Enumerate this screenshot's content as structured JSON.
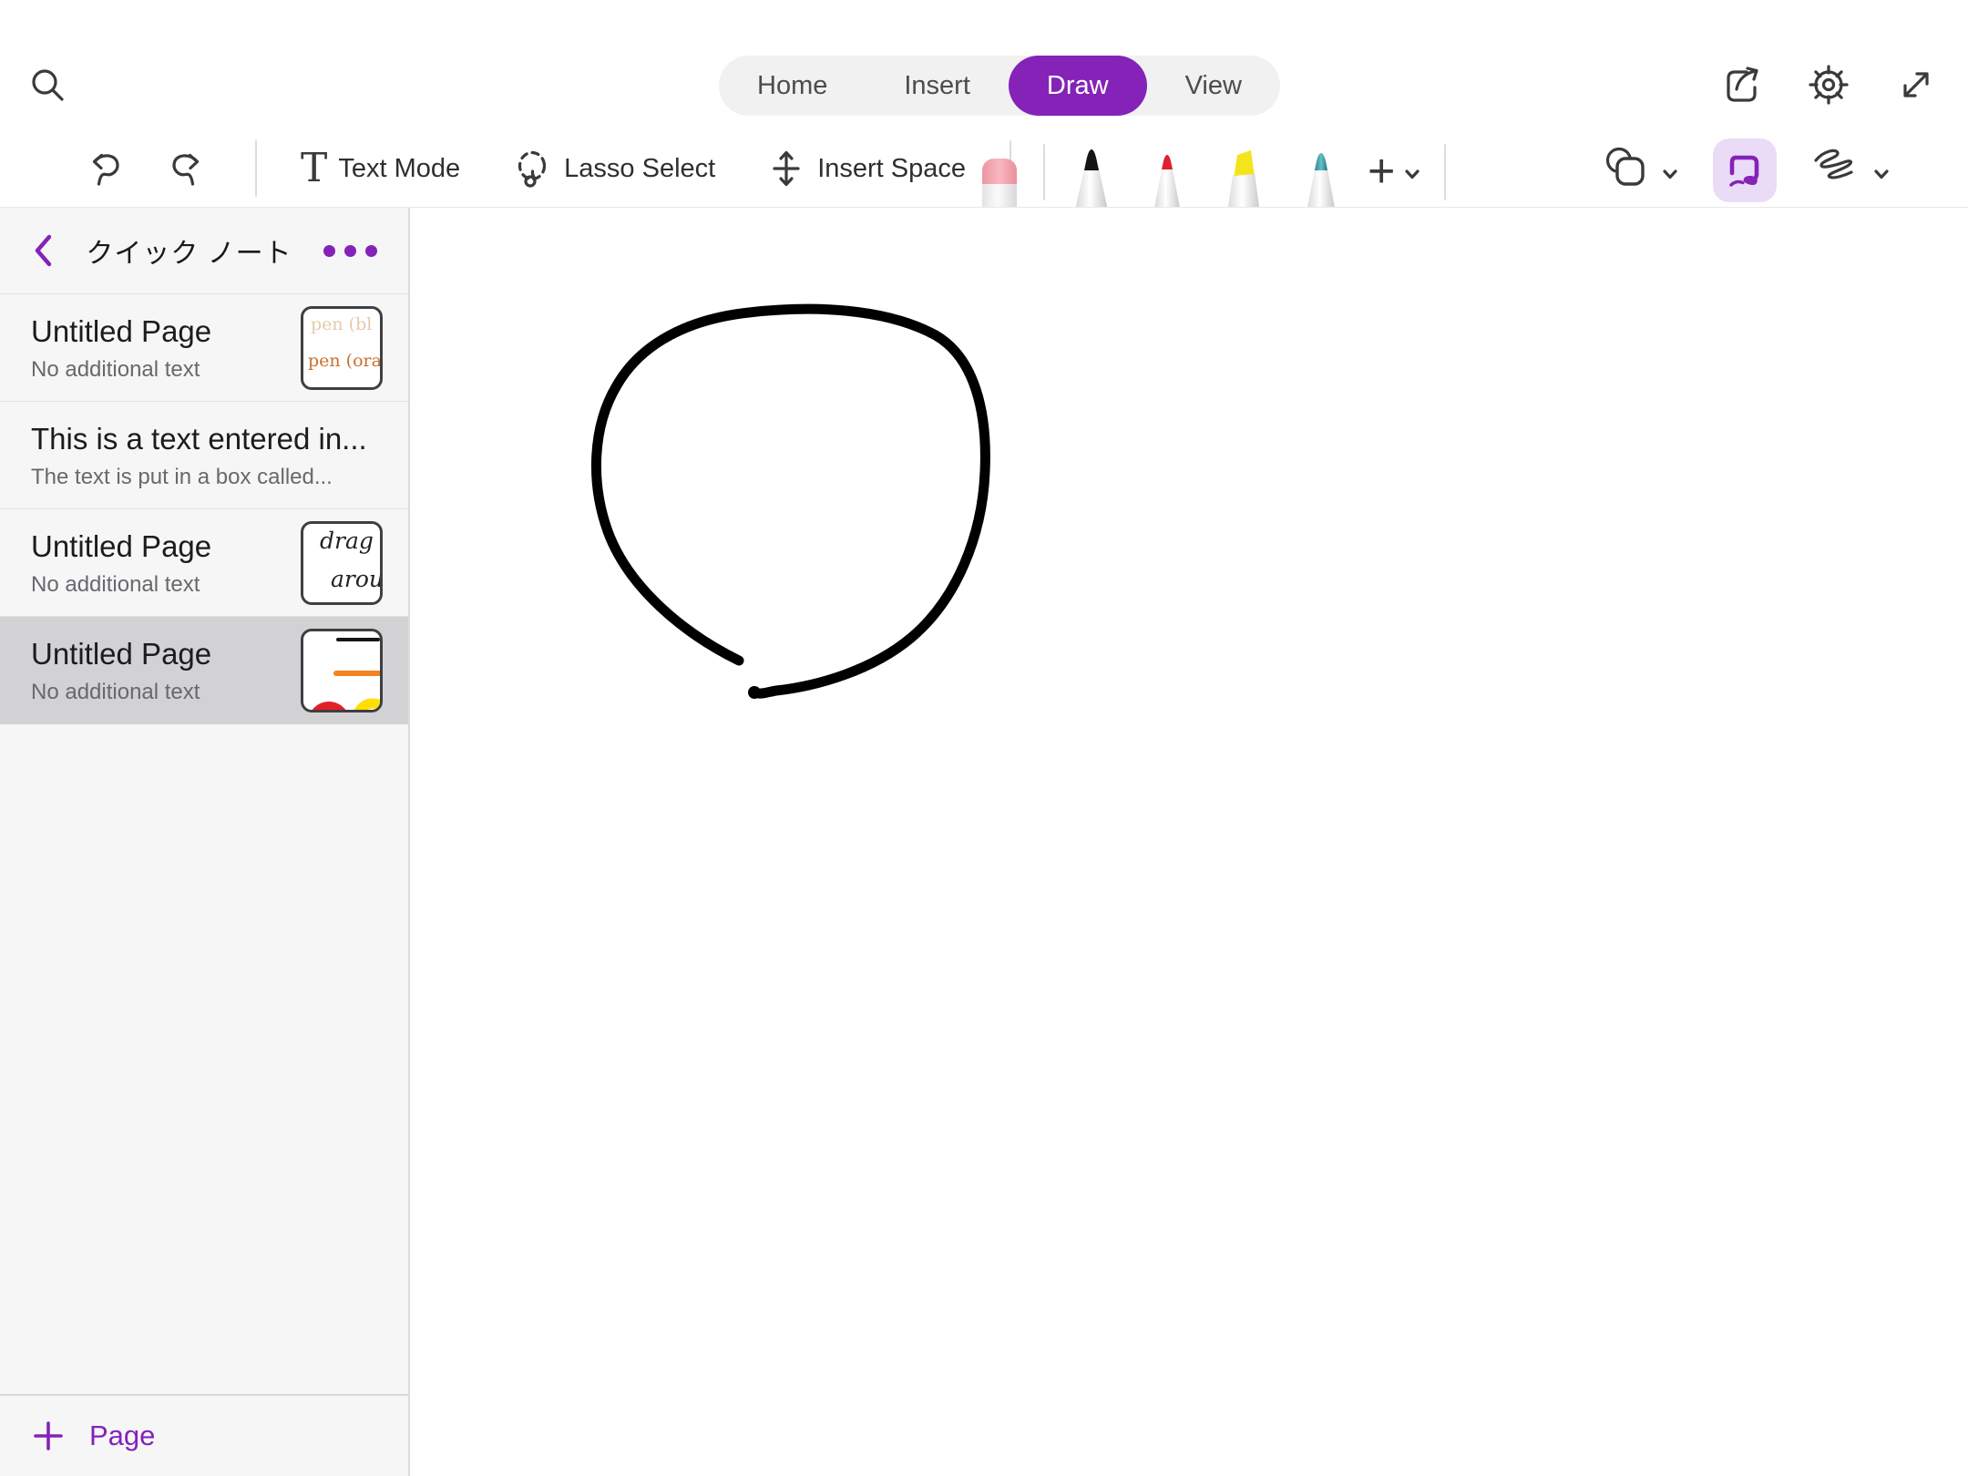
{
  "theme": {
    "accent": "#8522b8",
    "accentLight": "#eadcf6",
    "icon": "#3a3a3c",
    "tabText": "#4c4c4f",
    "tabBg": "#f1f1f2",
    "hairline": "#e3e3e5",
    "sidebarBg": "#f6f6f7",
    "selectedBg": "#d2d2d4",
    "titleColor": "#1c1c1e",
    "subColor": "#68686d",
    "canvasBg": "#ffffff",
    "ink": "#000000",
    "orangeInk": "#c9702f",
    "faintInk": "#e6c9ad",
    "thumbOrange": "#f58220",
    "thumbRed": "#e22028",
    "thumbYellow": "#ffdf00"
  },
  "topbar": {
    "tabs": [
      {
        "label": "Home",
        "active": false
      },
      {
        "label": "Insert",
        "active": false
      },
      {
        "label": "Draw",
        "active": true
      },
      {
        "label": "View",
        "active": false
      }
    ],
    "icons": {
      "search": "search-icon",
      "share": "share-icon",
      "settings": "gear-icon",
      "expand": "expand-icon"
    }
  },
  "toolbar": {
    "undo": "undo-icon",
    "redo": "redo-icon",
    "text_mode_label": "Text Mode",
    "lasso_label": "Lasso Select",
    "insert_space_label": "Insert Space",
    "pens": [
      {
        "name": "eraser",
        "color": "#f5a8b0"
      },
      {
        "name": "black-pen",
        "color": "#111111"
      },
      {
        "name": "red-pen",
        "color": "#e02030"
      },
      {
        "name": "yellow-highlighter",
        "color": "#f5e500"
      },
      {
        "name": "teal-galaxy-pencil",
        "color": "#44b0ac"
      }
    ],
    "add_pen_label": "+",
    "shapes_tool": "shapes-icon",
    "ink_to_shape_tool": {
      "name": "ink-to-shape",
      "active": true
    },
    "scribble_tool": "scribble-icon"
  },
  "sidebar": {
    "back": "‹",
    "title": "クイック ノート",
    "more": "•••",
    "pages": [
      {
        "title": "Untitled Page",
        "subtitle": "No additional text",
        "thumbnail": {
          "line1": "pen (bl",
          "line2": "pen (ora"
        },
        "selected": false
      },
      {
        "title": "This is a text entered in...",
        "subtitle": "The text is put in a box called...",
        "thumbnail": null,
        "selected": false
      },
      {
        "title": "Untitled Page",
        "subtitle": "No additional text",
        "thumbnail": {
          "line1": "drag",
          "line2": "arou"
        },
        "selected": false
      },
      {
        "title": "Untitled Page",
        "subtitle": "No additional text",
        "thumbnail": {
          "drawing": "black line, orange line, red half-circle, yellow ring"
        },
        "selected": true
      }
    ],
    "footer": {
      "add_page_label": "Page"
    }
  },
  "canvas": {
    "drawing": "hand-drawn open circle, black ink",
    "stroke_color": "#000000",
    "stroke_width": 11
  }
}
